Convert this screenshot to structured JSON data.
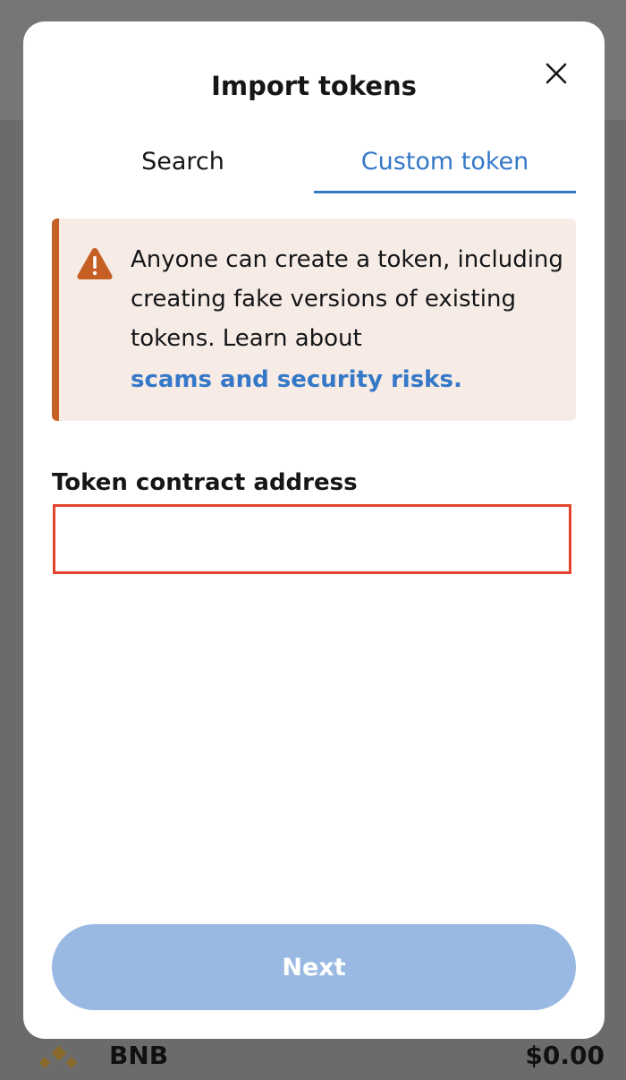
{
  "modal": {
    "title": "Import tokens",
    "close_icon": "close-icon"
  },
  "tabs": [
    {
      "label": "Search",
      "active": false
    },
    {
      "label": "Custom token",
      "active": true
    }
  ],
  "warning": {
    "icon": "warning-icon",
    "text": "Anyone can create a token, including creating fake versions of existing tokens. Learn about",
    "link_text": "scams and security risks."
  },
  "contract_field": {
    "label": "Token contract address",
    "value": "",
    "placeholder": ""
  },
  "next_button": {
    "label": "Next",
    "disabled": true
  },
  "background_asset": {
    "name": "BNB",
    "value": "$0.00",
    "icon": "bnb-coin-icon"
  },
  "colors": {
    "accent": "#3578c7",
    "warning_border": "#c65f24",
    "warning_bg": "#f7ebe6",
    "input_highlight": "#e2452c",
    "disabled_button": "#99b9e2"
  }
}
